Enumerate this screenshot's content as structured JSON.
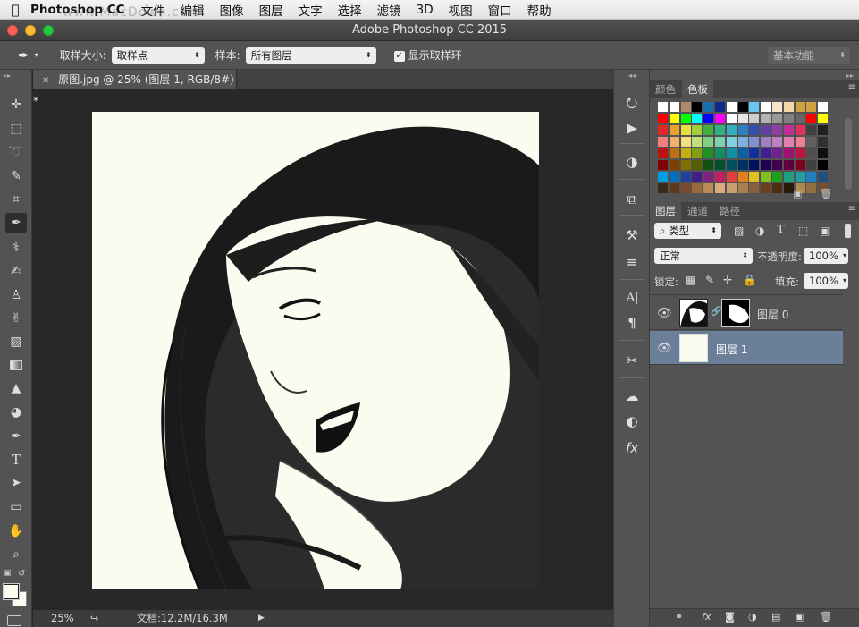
{
  "menubar": {
    "app_name": "Photoshop CC",
    "items": [
      "文件",
      "编辑",
      "图像",
      "图层",
      "文字",
      "选择",
      "滤镜",
      "3D",
      "视图",
      "窗口",
      "帮助"
    ],
    "watermark": "www.MacDown.com"
  },
  "window": {
    "title": "Adobe Photoshop CC 2015"
  },
  "options_bar": {
    "sample_size_label": "取样大小:",
    "sample_size_value": "取样点",
    "sample_label": "样本:",
    "sample_value": "所有图层",
    "show_ring_label": "显示取样环",
    "show_ring_checked": true,
    "workspace_value": "基本功能"
  },
  "document": {
    "tab_title": "原图.jpg @ 25% (图层 1, RGB/8#) *",
    "zoom": "25%",
    "doc_size": "文档:12.2M/16.3M",
    "canvas_color": "#fcfbf0"
  },
  "swatches_panel": {
    "tabs": [
      "颜色",
      "色板"
    ],
    "active_tab": "色板"
  },
  "layers_panel": {
    "tabs": [
      "图层",
      "通道",
      "路径"
    ],
    "active_tab": "图层",
    "filter_kind": "类型",
    "blend_mode": "正常",
    "opacity_label": "不透明度:",
    "opacity_value": "100%",
    "lock_label": "锁定:",
    "fill_label": "填充:",
    "fill_value": "100%",
    "layers": [
      {
        "name": "图层 0",
        "selected": false
      },
      {
        "name": "图层 1",
        "selected": true
      }
    ]
  },
  "colors": {
    "selected_layer": "#6c7f99",
    "panel_bg": "#535353"
  }
}
